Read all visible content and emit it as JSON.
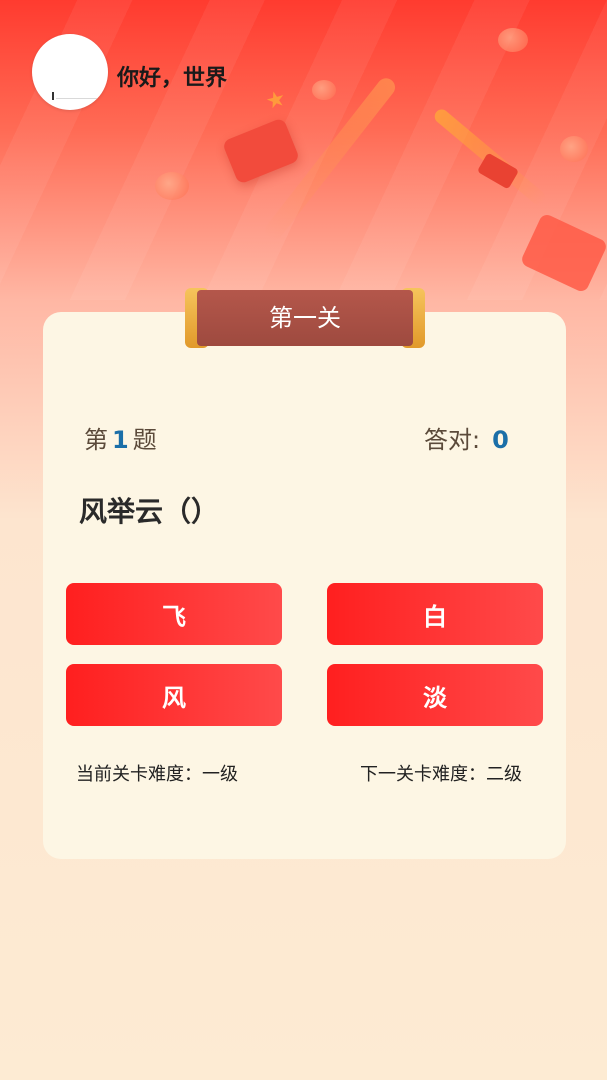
{
  "header": {
    "username": "你好，世界",
    "avatar_icon": "avatar-image"
  },
  "level": {
    "title": "第一关"
  },
  "quiz": {
    "question_prefix": "第",
    "question_number": "1",
    "question_suffix": "题",
    "correct_label": "答对:",
    "correct_count": "0",
    "question_text": "风举云（）",
    "options": [
      "飞",
      "白",
      "风",
      "淡"
    ]
  },
  "difficulty": {
    "current": "当前关卡难度：一级",
    "next": "下一关卡难度：二级"
  },
  "colors": {
    "accent_red": "#ff2a2a",
    "number_blue": "#1b6fa8",
    "card_bg": "#fdf6e4",
    "ribbon": "#a8503f"
  }
}
